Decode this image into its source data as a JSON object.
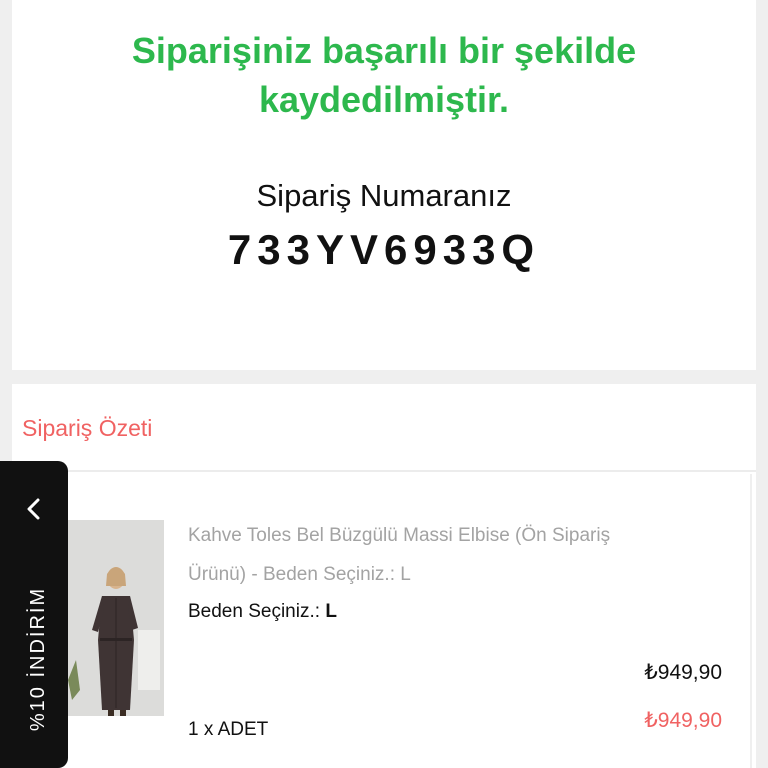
{
  "confirmation": {
    "success_message": "Siparişiniz başarılı bir şekilde kaydedilmiştir.",
    "order_label": "Sipariş Numaranız",
    "order_number": "733YV6933Q"
  },
  "summary": {
    "title": "Sipariş Özeti",
    "item": {
      "name": "Kahve Toles Bel Büzgülü Massi Elbise (Ön Sipariş Ürünü) - Beden Seçiniz.: L",
      "size_label": "Beden Seçiniz.: ",
      "size_value": "L",
      "price": "₺949,90",
      "discounted_price": "₺949,90",
      "quantity": "1 x ADET"
    }
  },
  "discount_tab": {
    "label": "%10 İNDİRİM",
    "icon": "chevron-left-icon"
  },
  "colors": {
    "success": "#2db84d",
    "accent": "#f06262",
    "tab_background": "#111111"
  }
}
